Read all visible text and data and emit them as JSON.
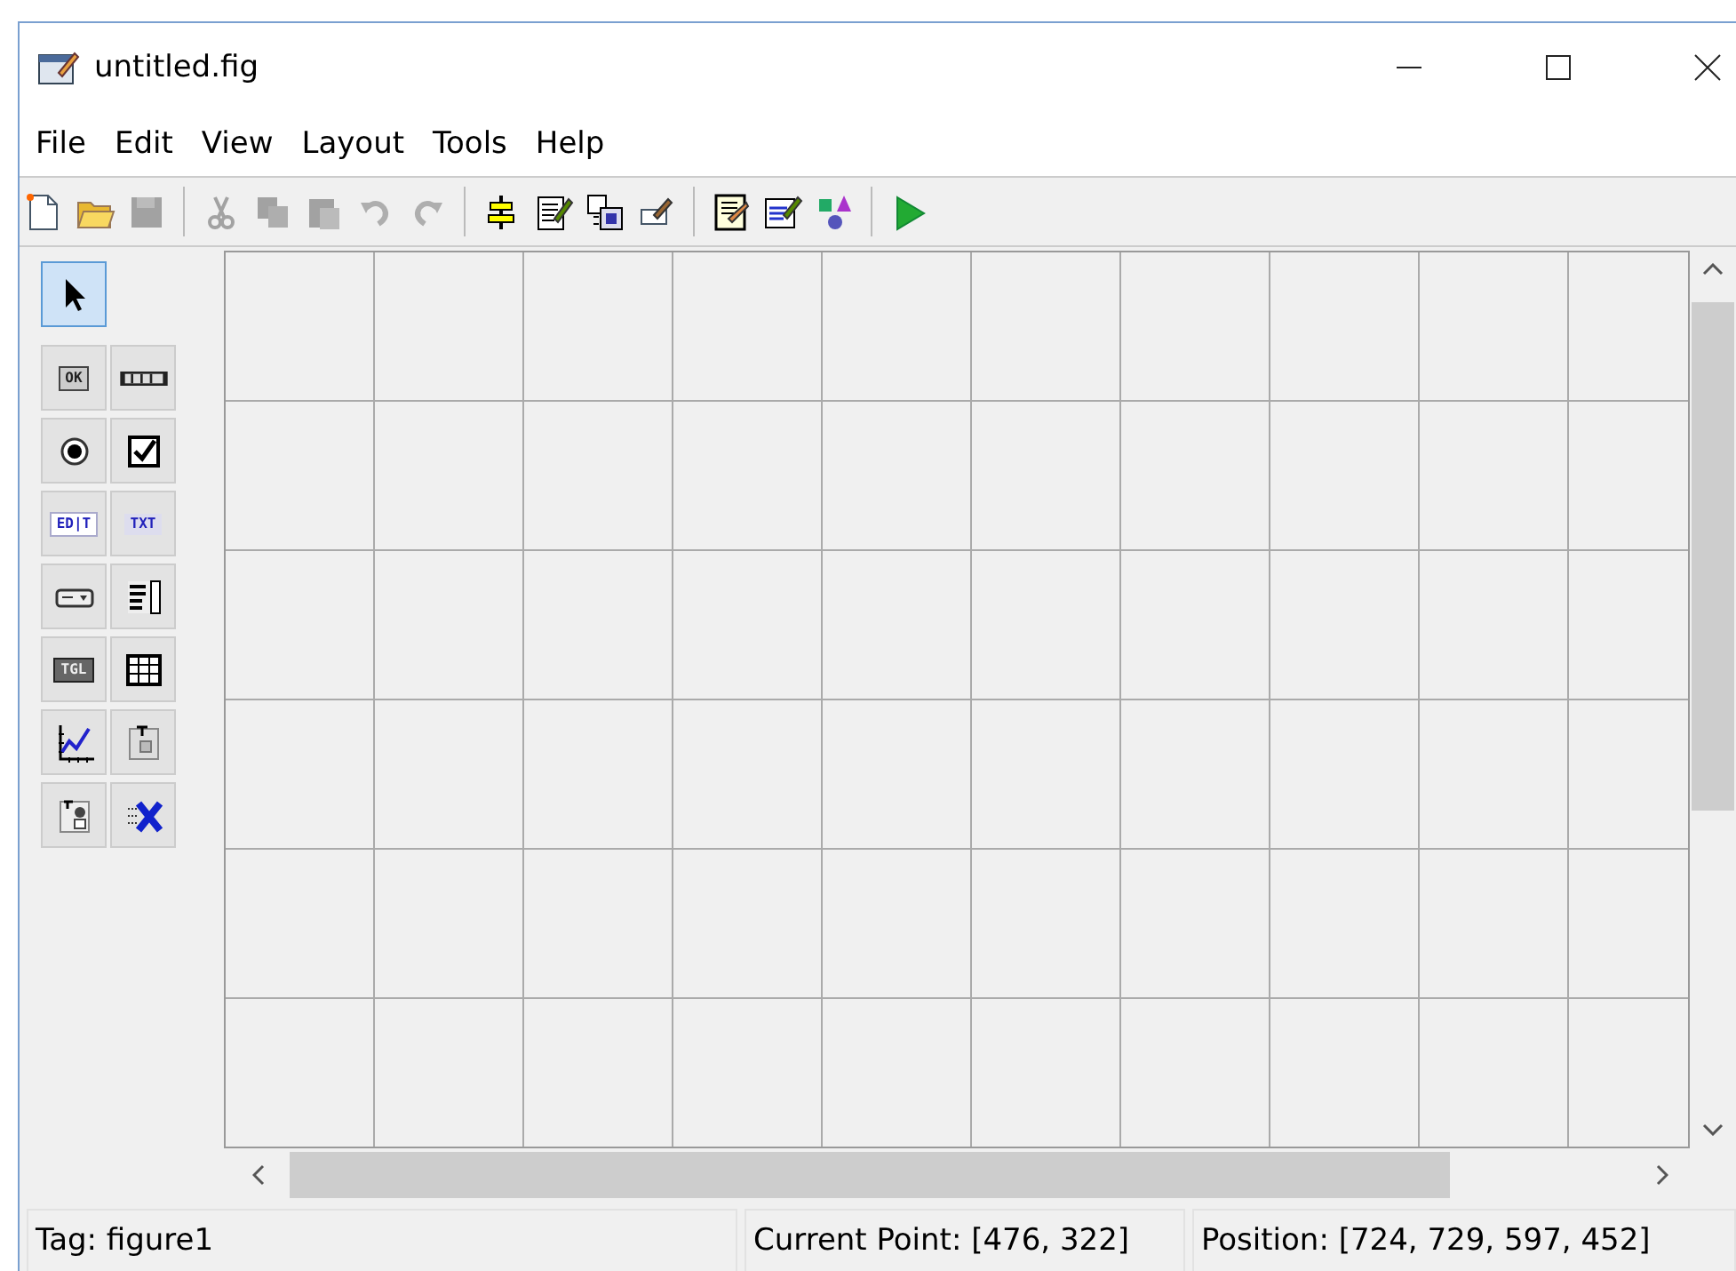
{
  "window": {
    "title": "untitled.fig"
  },
  "menu": [
    "File",
    "Edit",
    "View",
    "Layout",
    "Tools",
    "Help"
  ],
  "toolbar": [
    {
      "kind": "new",
      "disabled": false
    },
    {
      "kind": "open",
      "disabled": false
    },
    {
      "kind": "save",
      "disabled": true
    },
    {
      "kind": "sep"
    },
    {
      "kind": "cut",
      "disabled": true
    },
    {
      "kind": "copy",
      "disabled": true
    },
    {
      "kind": "paste",
      "disabled": true
    },
    {
      "kind": "undo",
      "disabled": true
    },
    {
      "kind": "redo",
      "disabled": true
    },
    {
      "kind": "sep"
    },
    {
      "kind": "align",
      "disabled": false
    },
    {
      "kind": "menu-editor",
      "disabled": false
    },
    {
      "kind": "tab-order",
      "disabled": false
    },
    {
      "kind": "toolbar-editor",
      "disabled": false
    },
    {
      "kind": "sep"
    },
    {
      "kind": "editor",
      "disabled": false
    },
    {
      "kind": "inspector",
      "disabled": false
    },
    {
      "kind": "browser",
      "disabled": false
    },
    {
      "kind": "sep"
    },
    {
      "kind": "run",
      "disabled": false
    }
  ],
  "palette": [
    {
      "kind": "pointer",
      "selected": true
    },
    {
      "kind": "push",
      "glyph": "OK",
      "selected": false
    },
    {
      "kind": "slider",
      "selected": false
    },
    {
      "kind": "radio",
      "selected": false
    },
    {
      "kind": "check",
      "selected": false
    },
    {
      "kind": "edit",
      "glyph": "ED|T",
      "selected": false
    },
    {
      "kind": "text",
      "glyph": "TXT",
      "selected": false
    },
    {
      "kind": "popup",
      "selected": false
    },
    {
      "kind": "listbox",
      "selected": false
    },
    {
      "kind": "toggle",
      "glyph": "TGL",
      "selected": false
    },
    {
      "kind": "table",
      "selected": false
    },
    {
      "kind": "axes",
      "selected": false
    },
    {
      "kind": "panel",
      "selected": false
    },
    {
      "kind": "buttongroup",
      "selected": false
    },
    {
      "kind": "activex",
      "selected": false
    }
  ],
  "status_bar": {
    "tag": "Tag: figure1",
    "current_point": "Current Point:  [476, 322]",
    "position": "Position: [724, 729, 597, 452]"
  }
}
